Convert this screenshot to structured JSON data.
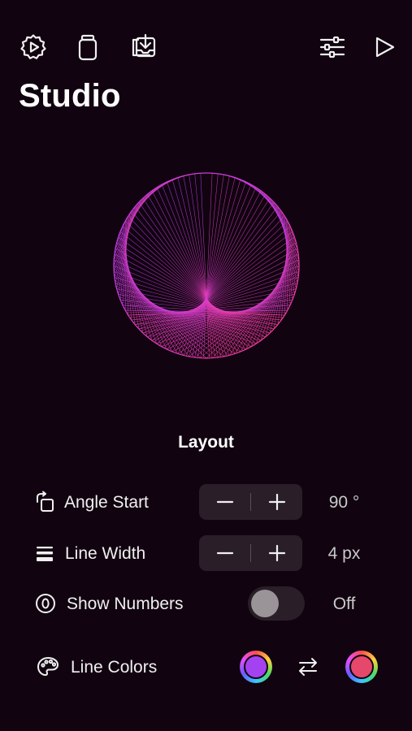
{
  "toolbar": {
    "left_icons": [
      "gear-play-icon",
      "jar-icon",
      "download-tray-icon"
    ],
    "right_icons": [
      "sliders-icon",
      "play-icon"
    ]
  },
  "page": {
    "title": "Studio"
  },
  "layout_section": {
    "title": "Layout",
    "angle_start": {
      "label": "Angle Start",
      "value": "90 °",
      "icon": "rotate-square-icon"
    },
    "line_width": {
      "label": "Line Width",
      "value": "4 px",
      "icon": "line-weight-icon"
    },
    "show_numbers": {
      "label": "Show Numbers",
      "value": "Off",
      "on": false,
      "icon": "number-zero-circle-icon"
    },
    "line_colors": {
      "label": "Line Colors",
      "icon": "palette-icon",
      "color_start": "#a441f0",
      "color_end": "#e5486b"
    }
  },
  "theme": {
    "background": "#110410",
    "art_gradient_start": "#b43cff",
    "art_gradient_end": "#ff3c8c"
  }
}
